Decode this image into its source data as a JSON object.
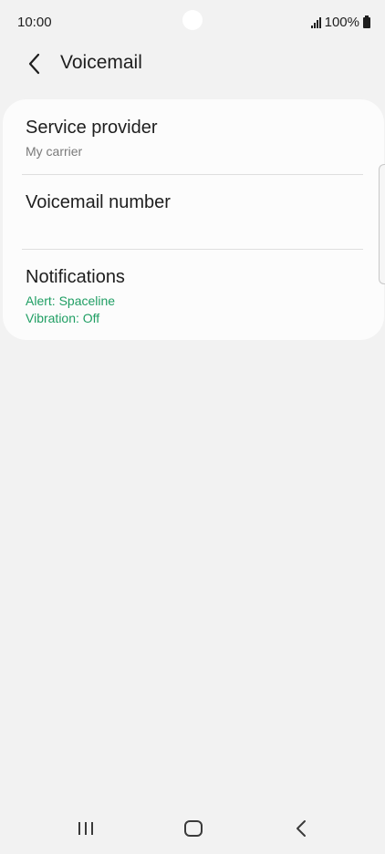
{
  "status_bar": {
    "time": "10:00",
    "battery_text": "100%",
    "icons": [
      "signal-icon",
      "battery-icon"
    ]
  },
  "app_bar": {
    "title": "Voicemail",
    "back_icon": "chevron-left-icon"
  },
  "settings": [
    {
      "title": "Service provider",
      "subtitle": "My carrier"
    },
    {
      "title": "Voicemail number"
    },
    {
      "title": "Notifications",
      "details": [
        "Alert: Spaceline",
        "Vibration: Off"
      ]
    }
  ],
  "navigation": {
    "buttons": [
      "recents-icon",
      "home-icon",
      "back-icon"
    ]
  },
  "colors": {
    "background": "#f2f2f2",
    "card": "#fcfcfc",
    "accent_green": "#1f9e63",
    "subtitle_gray": "#7a7a7a"
  }
}
